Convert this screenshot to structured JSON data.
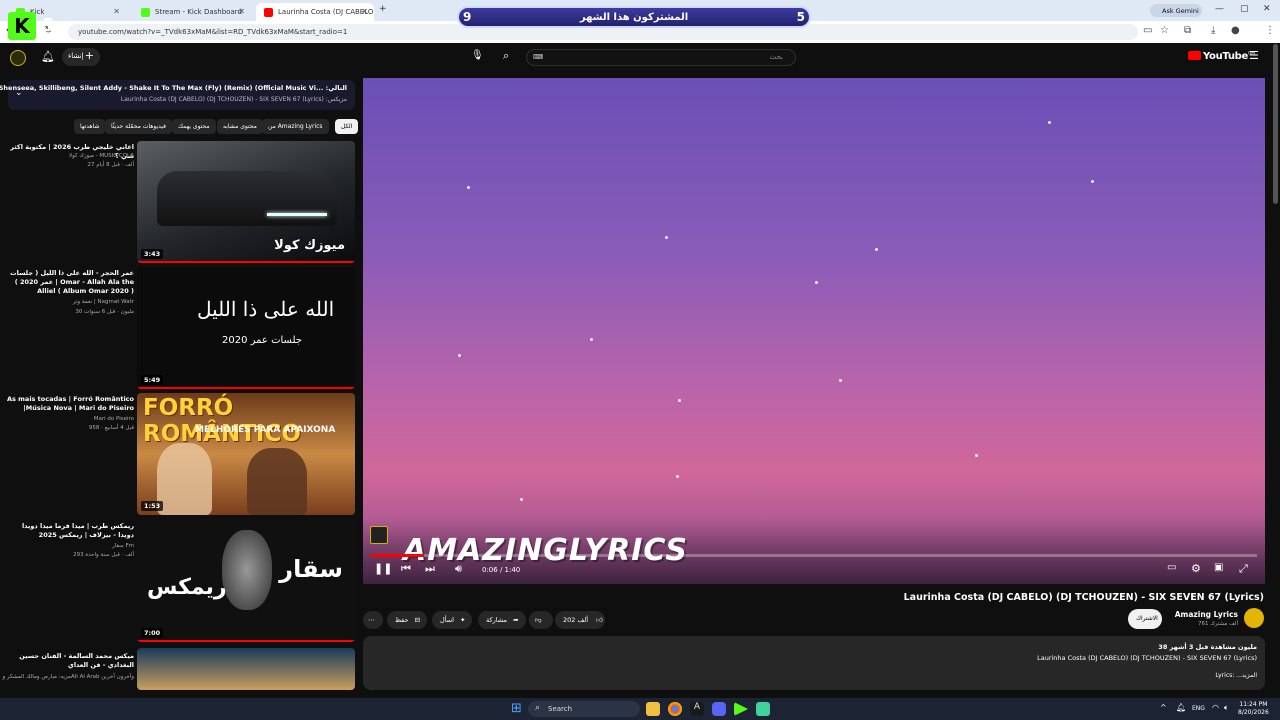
{
  "browser": {
    "tabs": [
      {
        "label": "Kick",
        "active": false
      },
      {
        "label": "Stream - Kick Dashboard",
        "active": false
      },
      {
        "label": "Laurinha Costa (DJ CABELO",
        "active": true
      }
    ],
    "gemini_label": "Ask Gemini",
    "url": "youtube.com/watch?v=_TVdk63xMaM&list=RD_TVdk63xMaM&start_radio=1"
  },
  "overlay": {
    "kick_letter": "K",
    "kick_count": "5",
    "subs_title": "المشتركون هذا الشهر",
    "subs_left": "9",
    "subs_right": "5"
  },
  "youtube": {
    "create_label": "إنشاء",
    "search_placeholder": "بحث",
    "logo_text": "YouTube",
    "logo_sup": "OM"
  },
  "playlist": {
    "line1": "MOLIY, Shenseea, Skillibeng, Silent Addy - Shake It To The Max (Fly) (Remix) (Official Music Vi... :التالي",
    "line2": "Laurinha Costa (DJ CABELO) (DJ TCHOUZEN) - SIX SEVEN 67 (Lyrics) :مزيكس"
  },
  "chips": [
    "الكل",
    "من Amazing Lyrics",
    "محتوى مشابه",
    "محتوى يهمك",
    "فيديوهات محمّلة حديثًا",
    "شاهدتها"
  ],
  "videos": [
    {
      "title": "اغاني خليجي طرب 2026 | مكتوبة اكثر شي ؟",
      "channel": "ميوزك كولا - MUSIC COLA",
      "meta": "27 ألف · قبل 8 أيام",
      "duration": "3:43",
      "thumb_text": "ميوزك كولا"
    },
    {
      "title": "عمر الحجر - الله على ذا الليل ( جلسات عمر 2020 ) | Omar - Allah Ala the Alliel ( Album Omar 2020 )",
      "channel": "نغمة وتر | Nagmat Watr",
      "meta": "30 مليون · قبل 6 سنوات",
      "duration": "5:49",
      "thumb_text": "الله على ذا الليل",
      "thumb_sub": "جلسات عمر 2020"
    },
    {
      "title": "As mais tocadas | Forró Romântico |Música Nova | Mari do Piseiro",
      "channel": "Mari do Piseiro",
      "meta": "958 · قبل 4 أسابيع",
      "duration": "1:53",
      "thumb_text": "FORRÓ ROMÂNTICO",
      "thumb_sub": "MELHORES PARA APAIXONA"
    },
    {
      "title": "ريمكس طرب | ميدا فرما ميدا دويدا دويدا - بيزلاف | ريمكس 2025",
      "channel": "سقار Fm",
      "meta": "293 ألف · قبل سنة واحدة",
      "duration": "7:00",
      "thumb_text": "سقار",
      "thumb_sub": "ريمكس"
    },
    {
      "title": "ميكس محمد السالمة - الفنان حسين البغدادي - فن العداي",
      "channel": "مزيه: مبارص ومالك المشكر وAli Al Arab وآخرون آخرين",
      "meta": "",
      "duration": "",
      "thumb_text": ""
    }
  ],
  "player": {
    "watermark": "AMAZINGLYRICS",
    "time": "0:06 / 1:40",
    "progress": 0.06
  },
  "video": {
    "title": "Laurinha Costa (DJ CABELO) (DJ TCHOUZEN) - SIX SEVEN 67 (Lyrics)",
    "channel": "Amazing Lyrics",
    "subscribers": "761 ألف مشترك",
    "subscribe_label": "الاشتراك",
    "like_count": "202 ألف",
    "share_label": "مشاركة",
    "ask_label": "اسأل",
    "save_label": "حفظ",
    "desc_stats": "38 مليون مشاهدة قبل 3 أشهر",
    "desc_line": "Laurinha Costa (DJ CABELO) (DJ TCHOUZEN) - SIX SEVEN 67 (Lyrics)",
    "desc_more": "Lyrics: ...المزيد"
  },
  "taskbar": {
    "search_label": "Search",
    "lang": "ENG",
    "time": "11:24 PM",
    "date": "8/20/2026"
  }
}
